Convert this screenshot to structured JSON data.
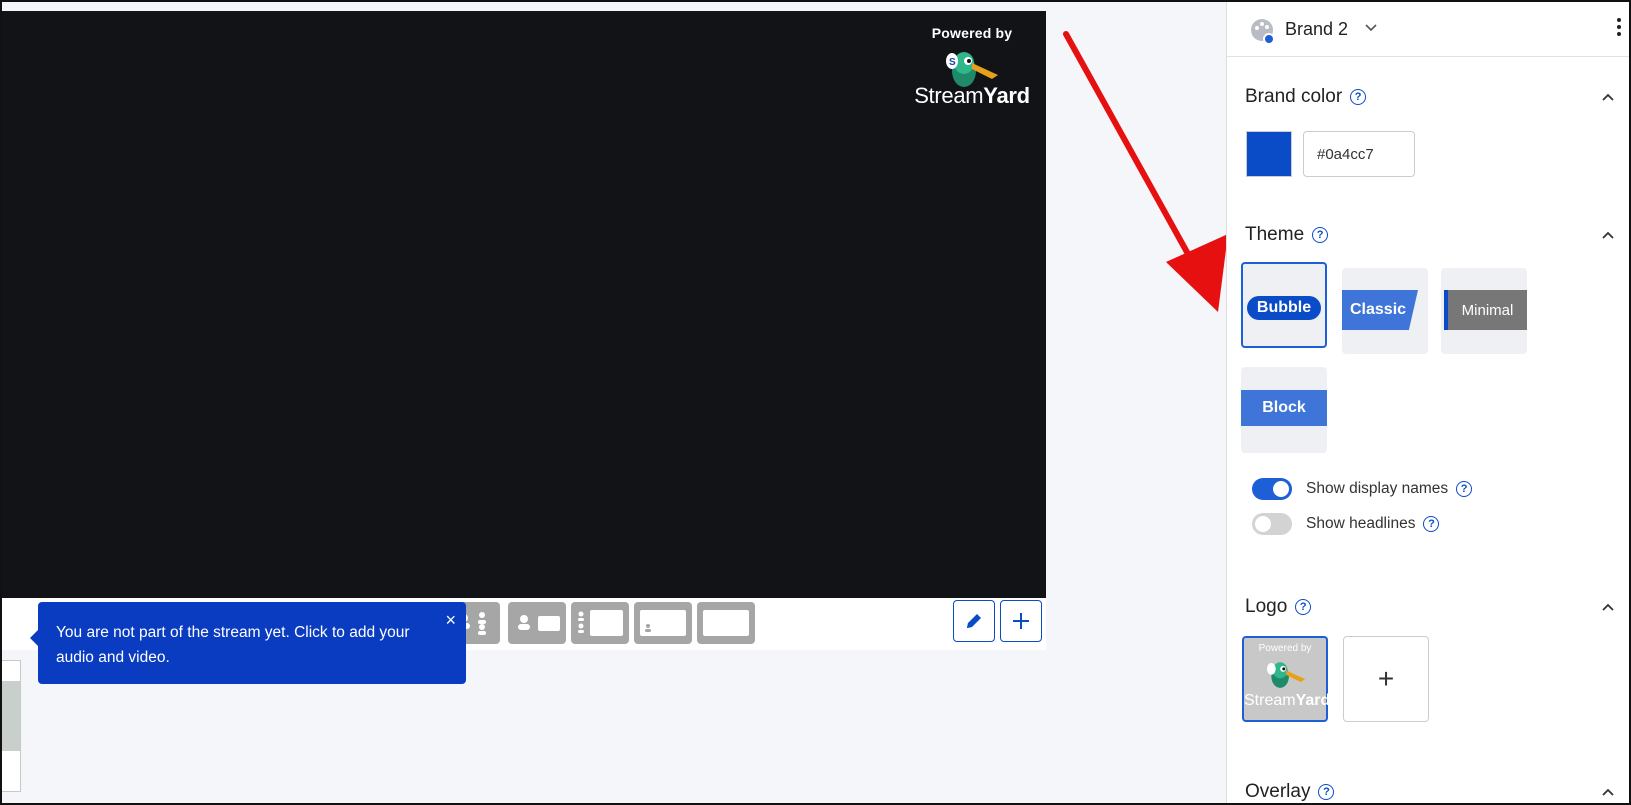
{
  "stage": {
    "powered_by": "Powered by",
    "brand_word_light": "Stream",
    "brand_word_bold": "Yard"
  },
  "toast": {
    "message": "You are not part of the stream yet. Click to add your audio and video.",
    "close_glyph": "×"
  },
  "panel": {
    "brand_name": "Brand 2",
    "sections": {
      "brand_color": {
        "title": "Brand color",
        "hex_value": "#0a4cc7",
        "color": "#0a4cc7"
      },
      "theme": {
        "title": "Theme",
        "options": [
          "Bubble",
          "Classic",
          "Minimal",
          "Block"
        ],
        "selected": "Bubble"
      },
      "toggles": [
        {
          "label": "Show display names",
          "on": true
        },
        {
          "label": "Show headlines",
          "on": false
        }
      ],
      "logo": {
        "title": "Logo",
        "mini_powered_by": "Powered by",
        "mini_word_light": "Stream",
        "mini_word_bold": "Yard",
        "add_glyph": "+"
      },
      "overlay": {
        "title": "Overlay"
      }
    }
  },
  "colors": {
    "accent": "#0a4cc7",
    "stage_bg": "#121316",
    "arrow": "#e61010"
  }
}
